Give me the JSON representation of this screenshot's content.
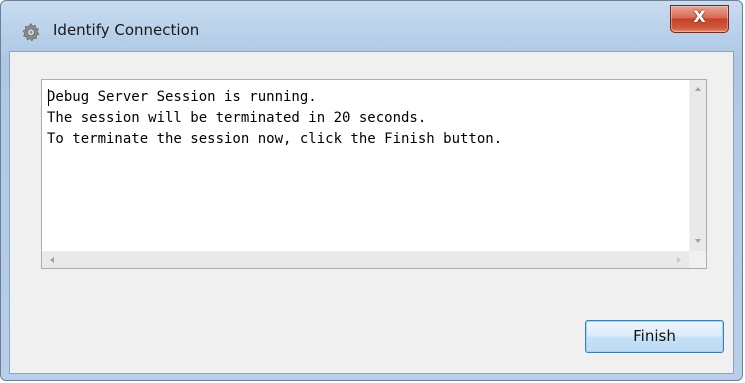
{
  "window": {
    "title": "Identify Connection",
    "close_label": "X",
    "app_icon": "gear-cog-icon"
  },
  "message": {
    "lines": [
      "Debug Server Session is running.",
      "The session will be terminated in 20 seconds.",
      "To terminate the session now, click the Finish button."
    ]
  },
  "buttons": {
    "finish_label": "Finish"
  },
  "colors": {
    "close_button": "#c5412a",
    "finish_border": "#3c7fb1",
    "client_background": "#f0f0f0"
  }
}
